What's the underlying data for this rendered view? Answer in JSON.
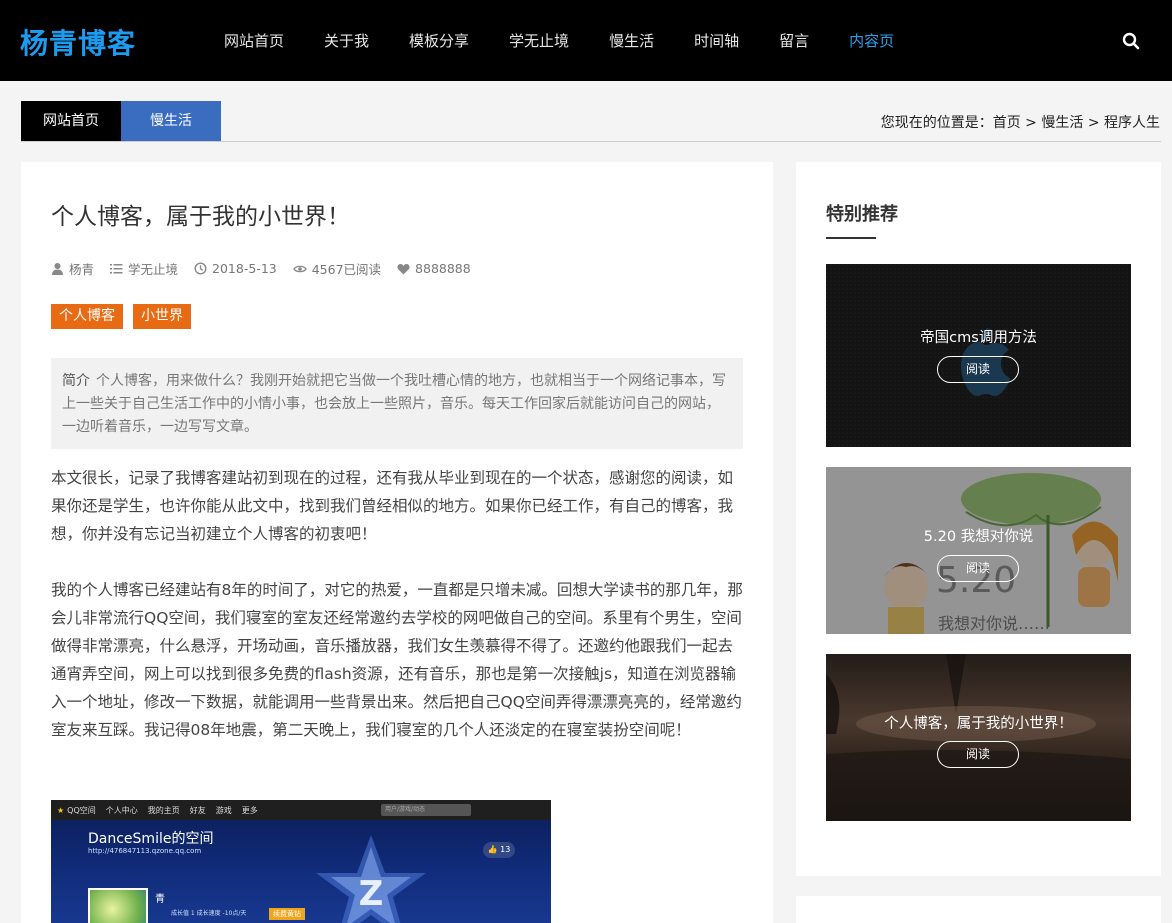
{
  "header": {
    "logo": "杨青博客",
    "nav": [
      "网站首页",
      "关于我",
      "模板分享",
      "学无止境",
      "慢生活",
      "时间轴",
      "留言",
      "内容页"
    ],
    "active_nav": "内容页",
    "search_icon": "search-icon"
  },
  "breadcrumb": {
    "tabs": [
      "网站首页",
      "慢生活"
    ],
    "location_prefix": "您现在的位置是：",
    "path": [
      "首页",
      "慢生活",
      "程序人生"
    ],
    "separator": ">"
  },
  "article": {
    "title": "个人博客，属于我的小世界！",
    "meta": {
      "author": "杨青",
      "category": "学无止境",
      "date": "2018-5-13",
      "reads": "4567已阅读",
      "likes": "8888888"
    },
    "tags": [
      "个人博客",
      "小世界"
    ],
    "intro_label": "简介",
    "intro": "个人博客，用来做什么？我刚开始就把它当做一个我吐槽心情的地方，也就相当于一个网络记事本，写上一些关于自己生活工作中的小情小事，也会放上一些照片，音乐。每天工作回家后就能访问自己的网站，一边听着音乐，一边写写文章。",
    "paragraphs": [
      "本文很长，记录了我博客建站初到现在的过程，还有我从毕业到现在的一个状态，感谢您的阅读，如果你还是学生，也许你能从此文中，找到我们曾经相似的地方。如果你已经工作，有自己的博客，我想，你并没有忘记当初建立个人博客的初衷吧！",
      "我的个人博客已经建站有8年的时间了，对它的热爱，一直都是只增未减。回想大学读书的那几年，那会儿非常流行QQ空间，我们寝室的室友还经常邀约去学校的网吧做自己的空间。系里有个男生，空间做得非常漂亮，什么悬浮，开场动画，音乐播放器，我们女生羡慕得不得了。还邀约他跟我们一起去通宵弄空间，网上可以找到很多免费的flash资源，还有音乐，那也是第一次接触js，知道在浏览器输入一个地址，修改一下数据，就能调用一些背景出来。然后把自己QQ空间弄得漂漂亮亮的，经常邀约室友来互踩。我记得08年地震，第二天晚上，我们寝室的几个人还淡定的在寝室装扮空间呢！"
    ],
    "screenshot": {
      "bar_items": [
        "QQ空间",
        "个人中心",
        "我的主页",
        "好友",
        "游戏",
        "更多"
      ],
      "search_placeholder": "用户/游戏/动态",
      "space_name": "DanceSmile的空间",
      "space_url": "http://476847113.qzone.qq.com",
      "like_count": "13",
      "user": "青",
      "level_text": "成长值 1  成长速度 -10点/天",
      "vip_label": "续费黄钻"
    }
  },
  "sidebar": {
    "title": "特别推荐",
    "items": [
      {
        "title": "帝国cms调用方法",
        "button": "阅读"
      },
      {
        "title": "5.20 我想对你说",
        "button": "阅读",
        "image_text_big": "5.20",
        "image_text_small": "我想对你说……"
      },
      {
        "title": "个人博客，属于我的小世界！",
        "button": "阅读"
      }
    ]
  },
  "colors": {
    "accent_blue": "#1c9cf0",
    "nav_active": "#2aa1ee",
    "tab_blue": "#3a6dbf",
    "tag_orange": "#e86a12"
  }
}
